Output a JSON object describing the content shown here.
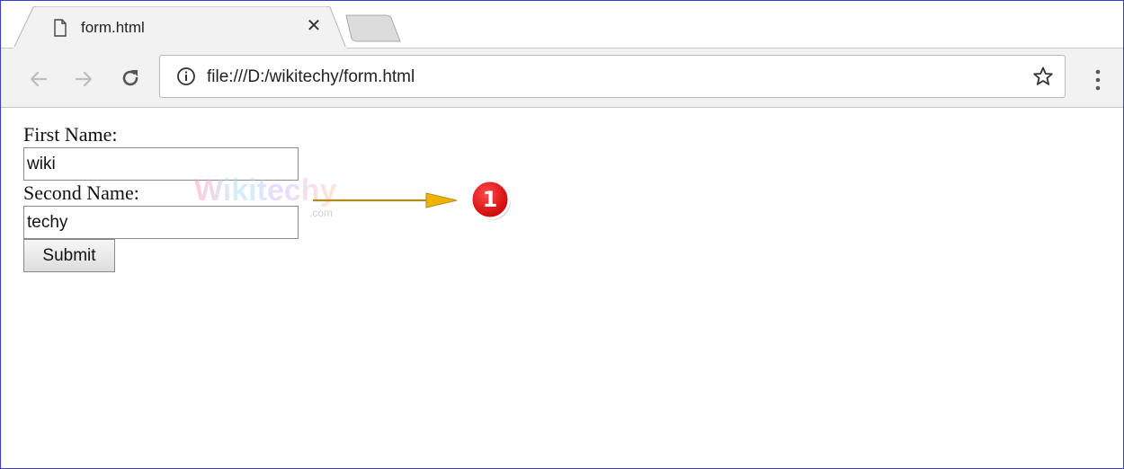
{
  "browser": {
    "tab": {
      "title": "form.html",
      "close_glyph": "✕",
      "icon": "page-icon"
    },
    "new_tab": {
      "icon": "new-tab-icon"
    },
    "toolbar": {
      "back_icon": "back-arrow-icon",
      "forward_icon": "forward-arrow-icon",
      "reload_icon": "reload-icon",
      "info_icon": "info-icon",
      "url": "file:///D:/wikitechy/form.html",
      "star_icon": "star-icon",
      "menu_icon": "kebab-menu-icon"
    }
  },
  "page": {
    "first_name": {
      "label": "First Name:",
      "value": "wiki"
    },
    "second_name": {
      "label": "Second Name:",
      "value": "techy"
    },
    "submit": {
      "label": "Submit"
    }
  },
  "watermark": {
    "brand": "Wikitechy",
    "domain": ".com"
  },
  "annotation": {
    "number": "1",
    "arrow_color": "#e8b200",
    "badge_color": "#e01b1b"
  },
  "colors": {
    "frame_border": "#3b3bd6",
    "toolbar_bg": "#f2f2f2"
  }
}
